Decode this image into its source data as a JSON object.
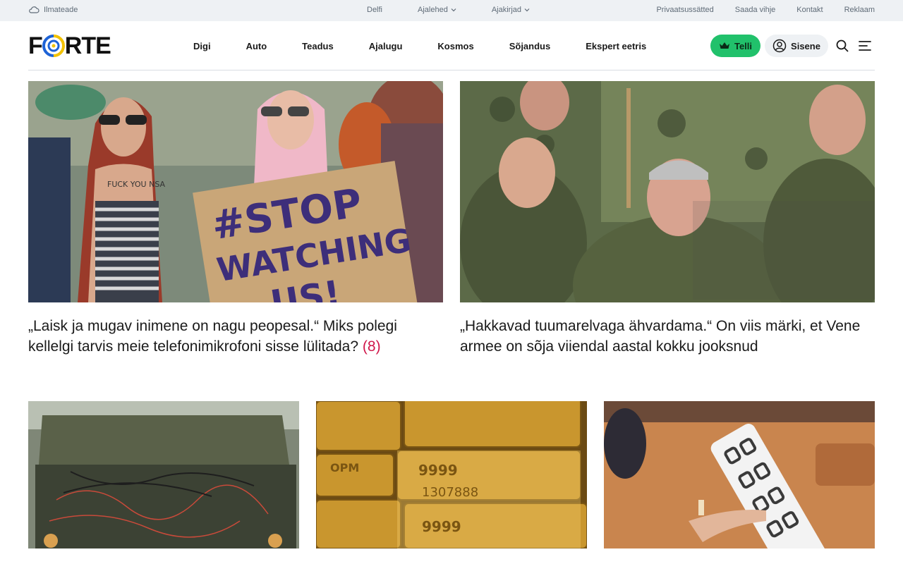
{
  "topbar": {
    "weather_label": "Ilmateade",
    "center_links": [
      {
        "label": "Delfi",
        "dropdown": false
      },
      {
        "label": "Ajalehed",
        "dropdown": true
      },
      {
        "label": "Ajakirjad",
        "dropdown": true
      }
    ],
    "right_links": [
      "Privaatsussätted",
      "Saada vihje",
      "Kontakt",
      "Reklaam"
    ]
  },
  "header": {
    "logo_text": "FORTE",
    "nav": [
      "Digi",
      "Auto",
      "Teadus",
      "Ajalugu",
      "Kosmos",
      "Sõjandus",
      "Ekspert eetris"
    ],
    "subscribe_label": "Telli",
    "login_label": "Sisene",
    "accent_green": "#21c16b"
  },
  "articles": [
    {
      "image_text": [
        "FUCK YOU NSA",
        "#STOP",
        "WATCHING",
        "US!"
      ],
      "headline": "„Laisk ja mugav inimene on nagu peopesal.“ Miks polegi kellelgi tarvis meie telefonimikrofoni sisse lülitada?",
      "comment_count": "(8)"
    },
    {
      "headline": "„Hakkavad tuumarelvaga ähvardama.“ On viis märki, et Vene armee on sõja viiendal aastal kokku jooksnud"
    },
    {},
    {
      "image_text": [
        "9999",
        "1307888",
        "OPM"
      ]
    },
    {}
  ]
}
